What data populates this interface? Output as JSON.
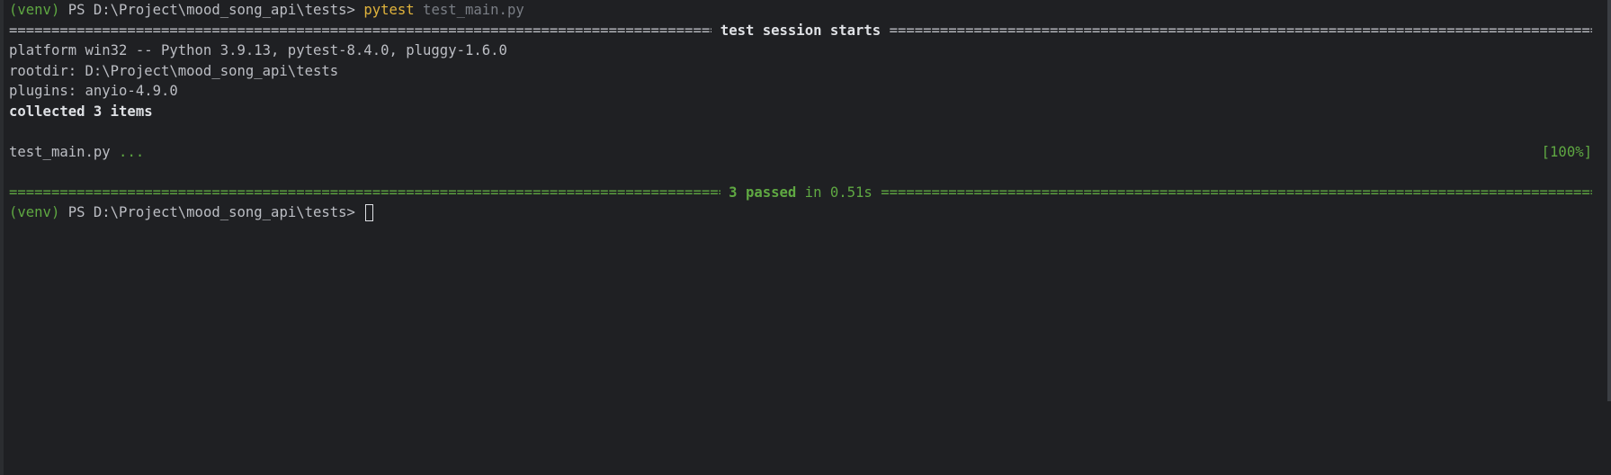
{
  "prompt": {
    "venv": "(venv)",
    "path": " PS D:\\Project\\mood_song_api\\tests> "
  },
  "command": {
    "name": "pytest",
    "args": " test_main.py"
  },
  "session": {
    "header_label": " test session starts ",
    "rule_char": "=",
    "platform": "platform win32 -- Python 3.9.13, pytest-8.4.0, pluggy-1.6.0",
    "rootdir": "rootdir: D:\\Project\\mood_song_api\\tests",
    "plugins": "plugins: anyio-4.9.0",
    "collected": "collected 3 items",
    "test_file": "test_main.py",
    "test_dots": " ...",
    "progress": "[100%]",
    "summary_passed": " 3 passed",
    "summary_time": " in 0.51s "
  },
  "colors": {
    "background": "#1f2023",
    "green": "#5fa842",
    "yellow": "#e0b33c",
    "text": "#bcbec4"
  }
}
